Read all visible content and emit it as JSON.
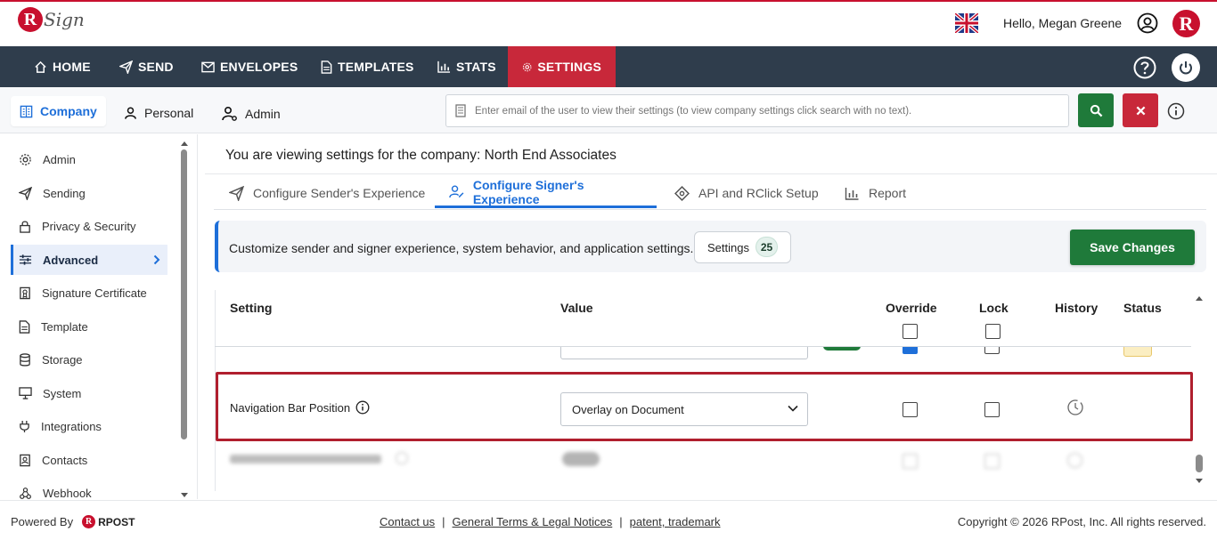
{
  "header": {
    "logo_letter": "R",
    "logo_text": "Sign",
    "greeting": "Hello, Megan Greene",
    "brand_letter": "R",
    "flag": "uk-flag-icon"
  },
  "nav": {
    "items": [
      {
        "label": "HOME",
        "icon": "home-icon"
      },
      {
        "label": "SEND",
        "icon": "send-icon"
      },
      {
        "label": "ENVELOPES",
        "icon": "envelope-icon"
      },
      {
        "label": "TEMPLATES",
        "icon": "document-icon"
      },
      {
        "label": "STATS",
        "icon": "bar-chart-icon"
      },
      {
        "label": "SETTINGS",
        "icon": "gear-icon",
        "active": true
      }
    ]
  },
  "subnav": {
    "tabs": [
      {
        "label": "Company",
        "active": true
      },
      {
        "label": "Personal"
      },
      {
        "label": "Admin"
      }
    ],
    "search_placeholder": "Enter email of the user to view their settings (to view company settings click search with no text)."
  },
  "sidebar": {
    "items": [
      {
        "label": "Admin",
        "icon": "gear-icon"
      },
      {
        "label": "Sending",
        "icon": "send-icon"
      },
      {
        "label": "Privacy & Security",
        "icon": "lock-icon"
      },
      {
        "label": "Advanced",
        "icon": "sliders-icon",
        "active": true
      },
      {
        "label": "Signature Certificate",
        "icon": "certificate-icon"
      },
      {
        "label": "Template",
        "icon": "document-icon"
      },
      {
        "label": "Storage",
        "icon": "database-icon"
      },
      {
        "label": "System",
        "icon": "monitor-icon"
      },
      {
        "label": "Integrations",
        "icon": "plug-icon"
      },
      {
        "label": "Contacts",
        "icon": "contact-icon"
      },
      {
        "label": "Webhook",
        "icon": "webhook-icon"
      }
    ]
  },
  "main": {
    "title": "You are viewing settings for the company: North End Associates",
    "tabs": [
      {
        "label": "Configure Sender's Experience"
      },
      {
        "label": "Configure Signer's Experience",
        "active": true
      },
      {
        "label": "API and RClick Setup"
      },
      {
        "label": "Report"
      }
    ],
    "banner_text": "Customize sender and signer experience, system behavior, and application settings.",
    "settings_label": "Settings",
    "settings_count": "25",
    "save_label": "Save Changes"
  },
  "table": {
    "headers": {
      "setting": "Setting",
      "value": "Value",
      "override": "Override",
      "lock": "Lock",
      "history": "History",
      "status": "Status"
    },
    "highlighted_row": {
      "label": "Navigation Bar Position",
      "value": "Overlay on Document",
      "override_checked": false,
      "lock_checked": false
    }
  },
  "footer": {
    "powered_by": "Powered By",
    "rpost": "RPOST",
    "links": [
      "Contact us",
      "General Terms & Legal Notices",
      "patent, trademark"
    ],
    "copyright": "Copyright © 2026 RPost, Inc. All rights reserved."
  },
  "colors": {
    "nav_bg": "#2f3d4c",
    "accent_red": "#c8283a",
    "accent_blue": "#1e6fd9",
    "accent_green": "#1f7a3a"
  }
}
